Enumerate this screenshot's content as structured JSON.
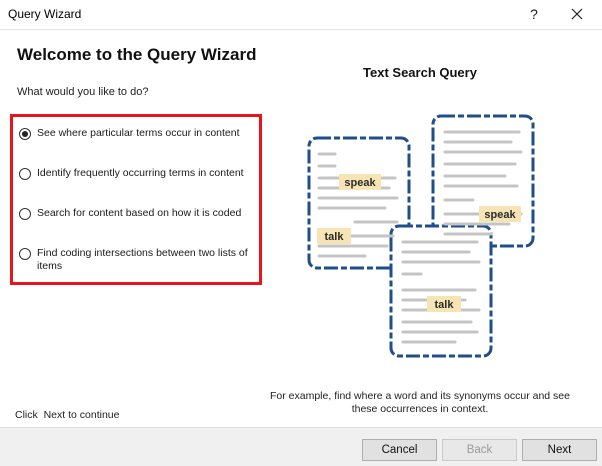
{
  "window": {
    "title": "Query Wizard",
    "help_glyph": "?",
    "icons": {
      "close": "close-icon",
      "help": "help-icon"
    }
  },
  "page": {
    "heading": "Welcome to the Query Wizard",
    "prompt": "What would you like to do?",
    "options": [
      {
        "label": "See where particular terms occur in content",
        "selected": true
      },
      {
        "label": "Identify frequently occurring terms in content",
        "selected": false
      },
      {
        "label": "Search for content based on how it is coded",
        "selected": false
      },
      {
        "label": "Find coding intersections between two lists of items",
        "selected": false
      }
    ],
    "illustration": {
      "title": "Text Search Query",
      "highlights": [
        "speak",
        "talk",
        "speak",
        "talk"
      ],
      "caption": "For example, find where a word and its synonyms occur and see these occurrences in context."
    },
    "hint": "Click  Next to continue"
  },
  "buttons": {
    "cancel": "Cancel",
    "back": "Back",
    "next": "Next"
  },
  "colors": {
    "highlight_border": "#e8141c",
    "doc_border": "#1f4e8c",
    "term_highlight": "#f6e4b4",
    "text_lines": "#c4c4c4"
  }
}
